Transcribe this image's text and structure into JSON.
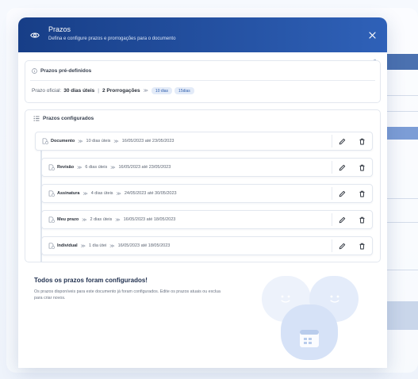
{
  "header": {
    "title": "Prazos",
    "subtitle": "Defina e configure prazos e prorrogações para o documento"
  },
  "predefined": {
    "title": "Prazos pré-definidos",
    "label": "Prazo oficial:",
    "official": "30 dias úteis",
    "separator": "|",
    "extensions": "2 Prorrogações",
    "tags": [
      "10 dias",
      "15dias"
    ]
  },
  "configured": {
    "title": "Prazos configurados",
    "rows": [
      {
        "name": "Documento",
        "duration": "10 dias úteis",
        "range": "16/05/2023 até 23/05/2023"
      },
      {
        "name": "Revisão",
        "duration": "6 dias úteis",
        "range": "16/05/2023 até 23/05/2023"
      },
      {
        "name": "Assinatura",
        "duration": "4 dias úteis",
        "range": "24/05/2023 até 30/05/2023"
      },
      {
        "name": "Meu prazo",
        "duration": "2 dias úteis",
        "range": "16/05/2023 até 18/05/2023"
      },
      {
        "name": "Individual",
        "duration": "1 dia útei",
        "range": "16/05/2023 até 18/05/2023"
      }
    ]
  },
  "done": {
    "title": "Todos os prazos foram configurados!",
    "description": "Os prazos disponíveis para este documento já foram configurados. Edite os prazos atuais ou exclua para criar novos."
  },
  "icons": {
    "header": "eye-icon",
    "close": "close-icon",
    "attach": "paperclip-icon",
    "info": "info-icon",
    "list": "list-icon",
    "row": "document-clock-icon",
    "edit": "pencil-icon",
    "delete": "trash-icon"
  },
  "colors": {
    "header_start": "#173e87",
    "header_end": "#2f61b8",
    "tag_bg": "#e3ebf8",
    "tag_text": "#2f5fae",
    "illustration": "#dbe6f8"
  }
}
